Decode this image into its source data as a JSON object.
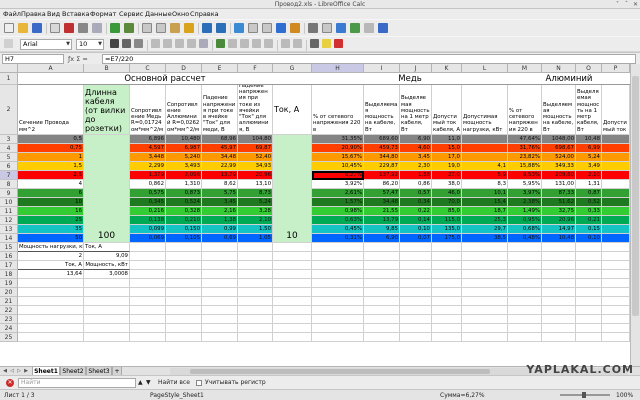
{
  "window": {
    "title": "Провод2.xls - LibreOffice Calc",
    "controls": [
      "˅",
      "ˆ",
      "✕"
    ]
  },
  "menu": [
    "Файл",
    "Правка",
    "Вид",
    "Вставка",
    "Формат",
    "Сервис",
    "Данные",
    "Окно",
    "Справка"
  ],
  "toolbar": {
    "font_name": "Arial",
    "font_size": "10"
  },
  "formula_bar": {
    "cell_ref": "H7",
    "fx_icons": "ƒx  Σ  =",
    "formula": "=E7/220"
  },
  "columns": [
    "A",
    "B",
    "C",
    "D",
    "E",
    "F",
    "G",
    "H",
    "I",
    "J",
    "K",
    "L",
    "M",
    "N",
    "O",
    "P"
  ],
  "selected_column": "H",
  "selected_row": "7",
  "rows": [
    "1",
    "2",
    "3",
    "4",
    "5",
    "6",
    "7",
    "8",
    "9",
    "10",
    "11",
    "12",
    "13",
    "14",
    "15",
    "16",
    "17",
    "18",
    "19",
    "20",
    "21",
    "22",
    "23",
    "24",
    "25"
  ],
  "sheet": {
    "row1": {
      "main_title": "Основной рассчет",
      "copper_title": "Медь",
      "alum_title": "Алюминий"
    },
    "row2": {
      "A": "Сечение Провода мм^2",
      "B": "Длинна кабеля (от вилки до розетки)",
      "C": "Сопротивление Медь R=0,01724 ом*мм^2/м",
      "D": "Сопротивление Аллюминий R=0,0262 ом*мм^2/м",
      "E": "Падение напряжения при токе в ячейке \"Ток\" для меди, В",
      "F": "Падение напряжения при токе из ячейки \"Ток\" для аллюминия, В",
      "G": "Ток, А",
      "H": "% от сетевого напряжения 220 в",
      "I": "Выделяемая мощность на кабеле, Вт",
      "J": "Выделяемая мощность на 1 метр кабеля, Вт",
      "K": "Допустимый ток кабеля, А",
      "L": "Допустимая мощность нагрузки, кВт",
      "M": "% от сетевого напряжения 220 в",
      "N": "Выделяемая мощность на кабеле, Вт",
      "O": "Выделяемая мощность на 1 метр кабеля, Вт",
      "P": "Допустимый ток"
    },
    "merged_values": {
      "length": "100",
      "current": "10"
    },
    "data_rows": [
      {
        "A": "0,5",
        "C": "6,896",
        "D": "10,480",
        "E": "68,96",
        "F": "104,80",
        "H": "31,35%",
        "I": "689,60",
        "J": "6,90",
        "K": "11,0",
        "L": "",
        "M": "47,64%",
        "N": "1048,00",
        "O": "10,48"
      },
      {
        "A": "0,75",
        "C": "4,597",
        "D": "6,987",
        "E": "45,97",
        "F": "69,87",
        "H": "20,90%",
        "I": "459,73",
        "J": "4,60",
        "K": "15,0",
        "L": "",
        "M": "31,76%",
        "N": "698,67",
        "O": "6,99"
      },
      {
        "A": "1",
        "C": "3,448",
        "D": "5,240",
        "E": "34,48",
        "F": "52,40",
        "H": "15,67%",
        "I": "344,80",
        "J": "3,45",
        "K": "17,0",
        "L": "",
        "M": "23,82%",
        "N": "524,00",
        "O": "5,24"
      },
      {
        "A": "1,5",
        "C": "2,299",
        "D": "3,493",
        "E": "22,99",
        "F": "34,93",
        "H": "10,45%",
        "I": "229,87",
        "J": "2,30",
        "K": "19,0",
        "L": "4,1",
        "M": "15,88%",
        "N": "349,33",
        "O": "3,49"
      },
      {
        "A": "2,5",
        "C": "1,379",
        "D": "2,096",
        "E": "13,79",
        "F": "20,96",
        "H": "6,27%",
        "I": "137,92",
        "J": "1,38",
        "K": "27,0",
        "L": "5,9",
        "M": "9,53%",
        "N": "209,60",
        "O": "2,10"
      },
      {
        "A": "4",
        "C": "0,862",
        "D": "1,310",
        "E": "8,62",
        "F": "13,10",
        "H": "3,92%",
        "I": "86,20",
        "J": "0,86",
        "K": "38,0",
        "L": "8,3",
        "M": "5,95%",
        "N": "131,00",
        "O": "1,31"
      },
      {
        "A": "6",
        "C": "0,575",
        "D": "0,873",
        "E": "5,75",
        "F": "8,73",
        "H": "2,61%",
        "I": "57,47",
        "J": "0,57",
        "K": "46,0",
        "L": "10,1",
        "M": "3,97%",
        "N": "87,33",
        "O": "0,87"
      },
      {
        "A": "10",
        "C": "0,345",
        "D": "0,524",
        "E": "3,45",
        "F": "5,24",
        "H": "1,57%",
        "I": "34,48",
        "J": "0,34",
        "K": "70,0",
        "L": "15,4",
        "M": "2,38%",
        "N": "51,62",
        "O": "0,52"
      },
      {
        "A": "16",
        "C": "0,216",
        "D": "0,328",
        "E": "2,16",
        "F": "3,28",
        "H": "0,98%",
        "I": "21,55",
        "J": "0,22",
        "K": "85,0",
        "L": "18,7",
        "M": "1,49%",
        "N": "32,75",
        "O": "0,33"
      },
      {
        "A": "25",
        "C": "0,138",
        "D": "0,210",
        "E": "1,38",
        "F": "2,10",
        "H": "0,63%",
        "I": "13,79",
        "J": "0,14",
        "K": "115,0",
        "L": "25,3",
        "M": "0,95%",
        "N": "20,96",
        "O": "0,21"
      },
      {
        "A": "35",
        "C": "0,099",
        "D": "0,150",
        "E": "0,99",
        "F": "1,50",
        "H": "0,45%",
        "I": "9,85",
        "J": "0,10",
        "K": "135,0",
        "L": "29,7",
        "M": "0,68%",
        "N": "14,97",
        "O": "0,15"
      },
      {
        "A": "50",
        "C": "0,069",
        "D": "0,105",
        "E": "0,69",
        "F": "1,05",
        "H": "0,31%",
        "I": "6,90",
        "J": "0,07",
        "K": "175,0",
        "L": "38,5",
        "M": "0,48%",
        "N": "10,48",
        "O": "0,10"
      }
    ],
    "row_colors": [
      "#848484",
      "#ff3f00",
      "#ff9900",
      "#ffcc00",
      "#ff0000",
      "#ffffff",
      "#33a033",
      "#1f7a1f",
      "#33cc33",
      "#00aa55",
      "#14c4c4",
      "#0066ff"
    ],
    "side_colors": {
      "B": "#c8f0c8",
      "G": "#c8f0c8"
    },
    "row15": {
      "A": "Мощность нагрузки, кВт",
      "B": "Ток, А"
    },
    "row16": {
      "A": "2",
      "B": "9,09"
    },
    "row17": {
      "A": "Ток, А",
      "B": "Мощность, кВт"
    },
    "row18": {
      "A": "13,64",
      "B": "3,0008"
    }
  },
  "tabs": [
    "Sheet1",
    "Sheet2",
    "Sheet3"
  ],
  "active_tab": "Sheet1",
  "find": {
    "placeholder": "Найти",
    "find_all": "Найти все",
    "match_case": "Учитывать регистр"
  },
  "watermark": "YAPLAKAL.COM",
  "status": {
    "sheet": "Лист 1 / 3",
    "page_style": "PageStyle_Sheet1",
    "sum": "Сумма=6,27%",
    "zoom": "100%"
  }
}
